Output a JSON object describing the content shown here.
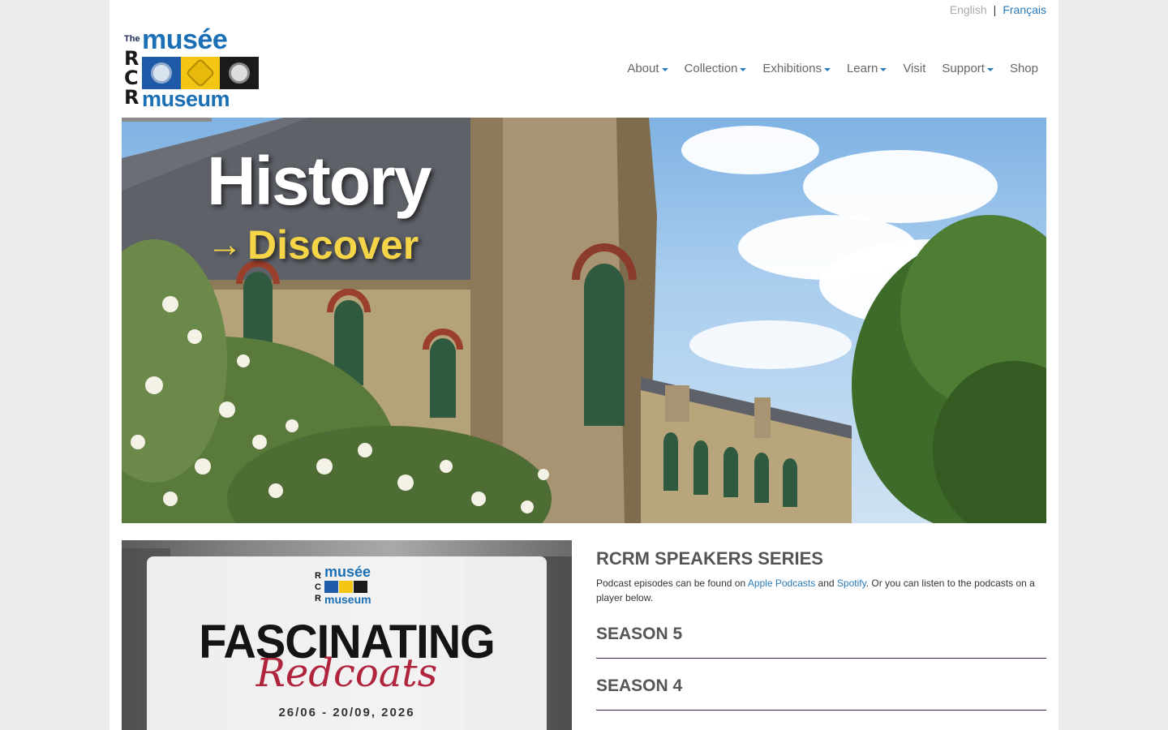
{
  "language": {
    "english": "English",
    "separator": "|",
    "french": "Français"
  },
  "logo": {
    "the": "The",
    "musee": "musée",
    "letters": [
      "R",
      "C",
      "R"
    ],
    "museum": "museum"
  },
  "nav": {
    "items": [
      {
        "label": "About",
        "dropdown": true
      },
      {
        "label": "Collection",
        "dropdown": true
      },
      {
        "label": "Exhibitions",
        "dropdown": true
      },
      {
        "label": "Learn",
        "dropdown": true
      },
      {
        "label": "Visit",
        "dropdown": false
      },
      {
        "label": "Support",
        "dropdown": true
      },
      {
        "label": "Shop",
        "dropdown": false
      }
    ]
  },
  "hero": {
    "title": "History",
    "arrow": "→",
    "subtitle": "Discover"
  },
  "poster": {
    "logo_musee": "musée",
    "logo_museum": "museum",
    "logo_letters": [
      "R",
      "C",
      "R"
    ],
    "headline": "FASCINATING",
    "script": "Redcoats",
    "dates": "26/06 - 20/09, 2026"
  },
  "series": {
    "title": "RCRM SPEAKERS SERIES",
    "text_before": "Podcast episodes can be found on ",
    "apple_link": "Apple Podcasts",
    "text_and": " and ",
    "spotify_link": "Spotify",
    "text_after": ". Or you can listen to the podcasts on a player below.",
    "seasons": [
      "SEASON 5",
      "SEASON 4"
    ]
  },
  "colors": {
    "link": "#2a7ab8",
    "accent_yellow": "#f5d547",
    "season_rule": "#3b1e5a"
  }
}
